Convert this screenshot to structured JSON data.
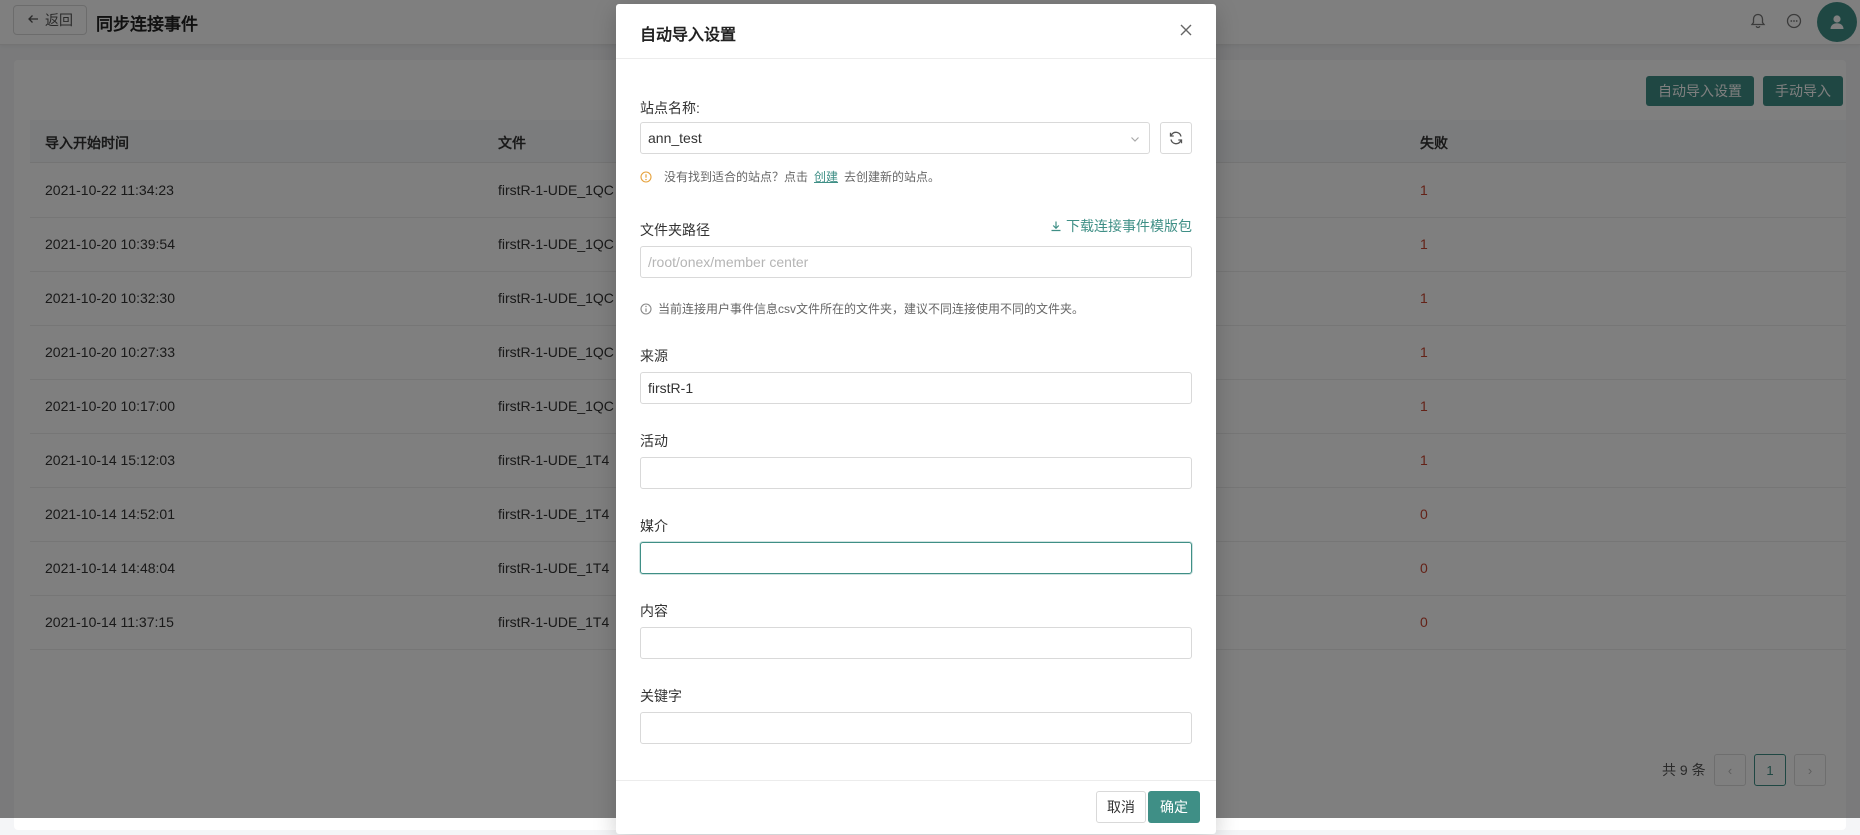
{
  "header": {
    "back_label": "返回",
    "title": "同步连接事件"
  },
  "toolbar": {
    "auto_import_settings_label": "自动导入设置",
    "manual_import_label": "手动导入"
  },
  "table": {
    "columns": [
      "导入开始时间",
      "文件",
      "失败"
    ],
    "rows": [
      {
        "time": "2021-10-22 11:34:23",
        "file": "firstR-1-UDE_1QC",
        "failed": "1"
      },
      {
        "time": "2021-10-20 10:39:54",
        "file": "firstR-1-UDE_1QC",
        "failed": "1"
      },
      {
        "time": "2021-10-20 10:32:30",
        "file": "firstR-1-UDE_1QC",
        "failed": "1"
      },
      {
        "time": "2021-10-20 10:27:33",
        "file": "firstR-1-UDE_1QC",
        "failed": "1"
      },
      {
        "time": "2021-10-20 10:17:00",
        "file": "firstR-1-UDE_1QC",
        "failed": "1"
      },
      {
        "time": "2021-10-14 15:12:03",
        "file": "firstR-1-UDE_1T4",
        "failed": "1"
      },
      {
        "time": "2021-10-14 14:52:01",
        "file": "firstR-1-UDE_1T4",
        "failed": "0"
      },
      {
        "time": "2021-10-14 14:48:04",
        "file": "firstR-1-UDE_1T4",
        "failed": "0"
      },
      {
        "time": "2021-10-14 11:37:15",
        "file": "firstR-1-UDE_1T4",
        "failed": "0"
      }
    ]
  },
  "pagination": {
    "total_label": "共 9 条",
    "current_page": "1"
  },
  "modal": {
    "title": "自动导入设置",
    "site_name_label": "站点名称:",
    "site_name_value": "ann_test",
    "site_hint_prefix": "没有找到适合的站点？点击",
    "site_hint_link": "创建",
    "site_hint_suffix": "去创建新的站点。",
    "folder_path_label": "文件夹路径",
    "download_template_label": "下载连接事件模版包",
    "folder_path_placeholder": "/root/onex/member center",
    "folder_hint": "当前连接用户事件信息csv文件所在的文件夹，建议不同连接使用不同的文件夹。",
    "source_label": "来源",
    "source_value": "firstR-1",
    "campaign_label": "活动",
    "campaign_value": "",
    "medium_label": "媒介",
    "medium_value": "",
    "content_label": "内容",
    "content_value": "",
    "keyword_label": "关键字",
    "keyword_value": "",
    "cancel_label": "取消",
    "ok_label": "确定"
  },
  "colors": {
    "primary": "#3f8f86",
    "fail_text": "#c8442f",
    "warning_icon": "#e6a23c"
  }
}
